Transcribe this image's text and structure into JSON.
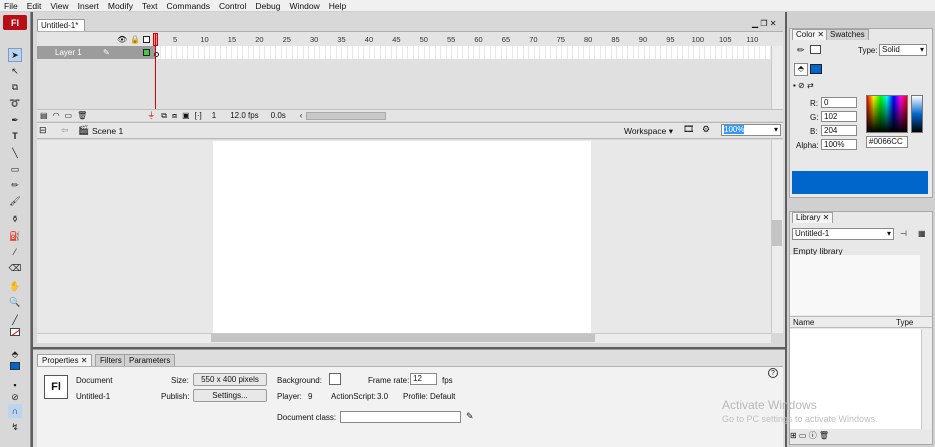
{
  "menu": [
    "File",
    "Edit",
    "View",
    "Insert",
    "Modify",
    "Text",
    "Commands",
    "Control",
    "Debug",
    "Window",
    "Help"
  ],
  "app_logo": "Fl",
  "document_tab": "Untitled-1*",
  "timeline": {
    "frame_numbers": [
      "5",
      "10",
      "15",
      "20",
      "25",
      "30",
      "35",
      "40",
      "45",
      "50",
      "55",
      "60",
      "65",
      "70",
      "75",
      "80",
      "85",
      "90",
      "95",
      "100",
      "105",
      "110"
    ],
    "layer_name": "Layer 1",
    "current_frame": "1",
    "fps": "12.0 fps",
    "time": "0.0s"
  },
  "scene": {
    "name": "Scene 1",
    "workspace_label": "Workspace",
    "zoom": "100%"
  },
  "properties": {
    "tabs": [
      "Properties",
      "Filters",
      "Parameters"
    ],
    "logo": "Fl",
    "doc_label": "Document",
    "doc_name": "Untitled-1",
    "size_label": "Size:",
    "size_value": "550 x 400 pixels",
    "publish_label": "Publish:",
    "settings_button": "Settings...",
    "background_label": "Background:",
    "framerate_label": "Frame rate:",
    "framerate_value": "12",
    "fps_unit": "fps",
    "player_label": "Player:",
    "player_value": "9",
    "actionscript_label": "ActionScript:",
    "actionscript_value": "3.0",
    "profile_label": "Profile:",
    "profile_value": "Default",
    "docclass_label": "Document class:",
    "docclass_value": ""
  },
  "color_panel": {
    "tabs": [
      "Color",
      "Swatches"
    ],
    "type_label": "Type:",
    "type_value": "Solid",
    "r_label": "R:",
    "r_value": "0",
    "g_label": "G:",
    "g_value": "102",
    "b_label": "B:",
    "b_value": "204",
    "alpha_label": "Alpha:",
    "alpha_value": "100%",
    "hex_value": "#0066CC",
    "swatch_color": "#0066CC"
  },
  "library_panel": {
    "tab": "Library",
    "doc_select": "Untitled-1",
    "empty_text": "Empty library",
    "col_name": "Name",
    "col_type": "Type"
  },
  "watermark": {
    "title": "Activate Windows",
    "subtitle": "Go to PC settings to activate Windows."
  }
}
